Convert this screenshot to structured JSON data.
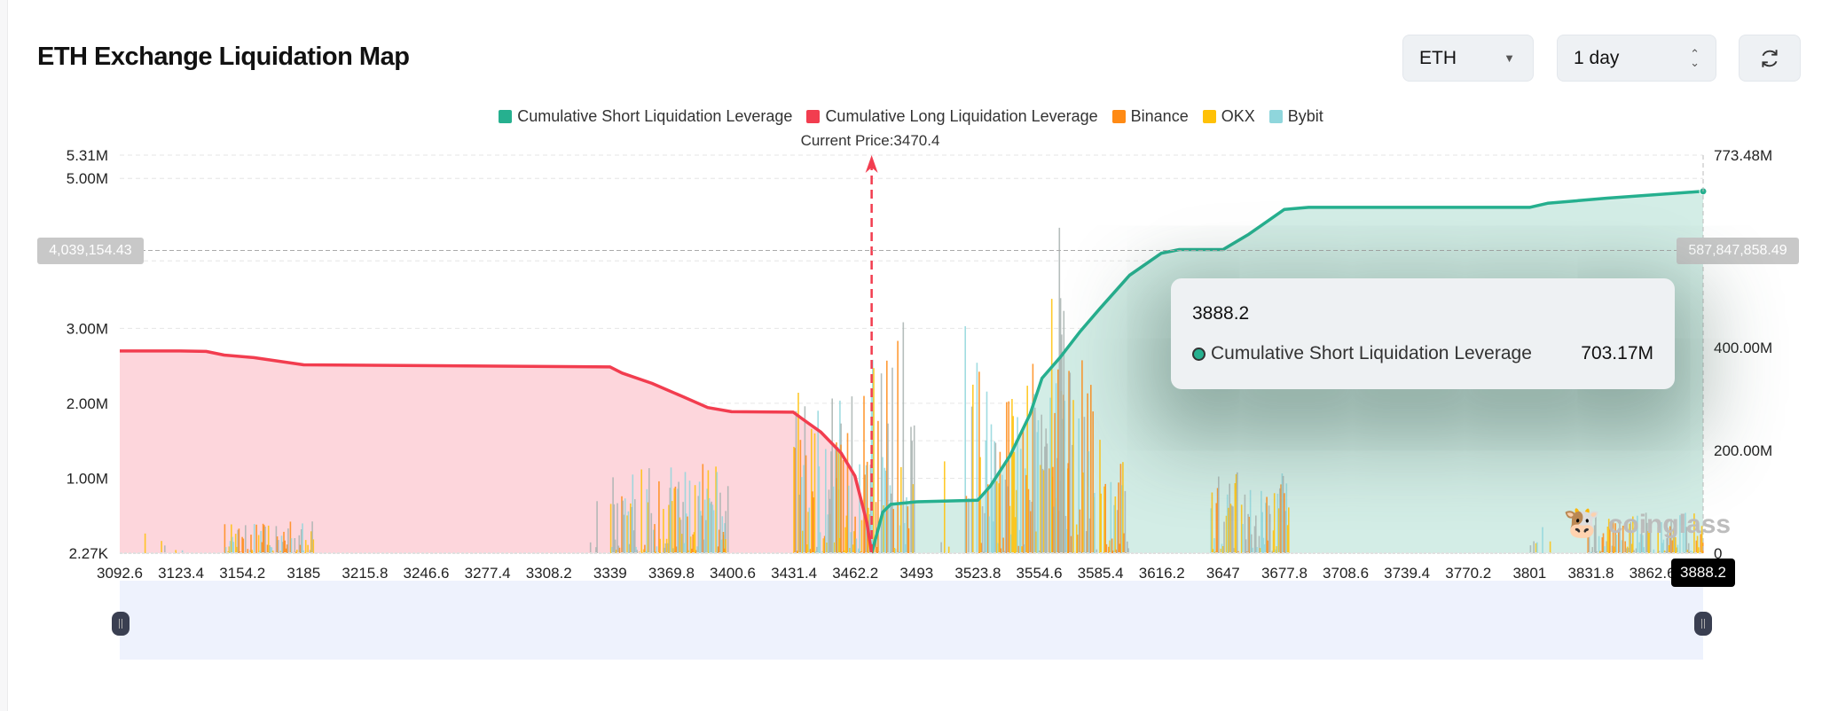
{
  "header": {
    "title": "ETH Exchange Liquidation Map",
    "coin_select": "ETH",
    "range_select": "1 day",
    "refresh_icon": "refresh-icon"
  },
  "legend": [
    {
      "label": "Cumulative Short Liquidation Leverage",
      "color": "#26b08f"
    },
    {
      "label": "Cumulative Long Liquidation Leverage",
      "color": "#f23d4f"
    },
    {
      "label": "Binance",
      "color": "#ff8a14"
    },
    {
      "label": "OKX",
      "color": "#ffc107"
    },
    {
      "label": "Bybit",
      "color": "#8fd6dc"
    }
  ],
  "current_price_label": "Current Price:3470.4",
  "tooltip": {
    "title": "3888.2",
    "series": "Cumulative Short Liquidation Leverage",
    "value": "703.17M"
  },
  "crosshair": {
    "left_value": "4,039,154.43",
    "right_value": "587,847,858.49",
    "x_value": "3888.2"
  },
  "watermark": "coinglass",
  "chart_data": {
    "type": "bar+area",
    "current_price": 3470.4,
    "x_range": [
      3092.6,
      3888.2
    ],
    "x_ticks": [
      "3092.6",
      "3123.4",
      "3154.2",
      "3185",
      "3215.8",
      "3246.6",
      "3277.4",
      "3308.2",
      "3339",
      "3369.8",
      "3400.6",
      "3431.4",
      "3462.2",
      "3493",
      "3523.8",
      "3554.6",
      "3585.4",
      "3616.2",
      "3647",
      "3677.8",
      "3708.6",
      "3739.4",
      "3770.2",
      "3801",
      "3831.8",
      "3862.6"
    ],
    "left_axis": {
      "range": [
        0,
        5.31
      ],
      "unit": "M",
      "ticks": [
        {
          "v": 5.31,
          "label": "5.31M"
        },
        {
          "v": 5.0,
          "label": "5.00M"
        },
        {
          "v": 3.0,
          "label": "3.00M"
        },
        {
          "v": 2.0,
          "label": "2.00M"
        },
        {
          "v": 1.0,
          "label": "1.00M"
        },
        {
          "v": 0,
          "label": "2.27K"
        }
      ]
    },
    "right_axis": {
      "range": [
        0,
        773.48
      ],
      "unit": "M",
      "ticks": [
        {
          "v": 773.48,
          "label": "773.48M"
        },
        {
          "v": 400,
          "label": "400.00M"
        },
        {
          "v": 200,
          "label": "200.00M"
        },
        {
          "v": 0,
          "label": "0"
        }
      ]
    },
    "grid": true,
    "legend_position": "top-center",
    "cumulative_long": [
      [
        3092.6,
        393
      ],
      [
        3123,
        393
      ],
      [
        3136,
        392
      ],
      [
        3145,
        385
      ],
      [
        3160,
        380
      ],
      [
        3185,
        366
      ],
      [
        3339,
        362
      ],
      [
        3345,
        350
      ],
      [
        3360,
        330
      ],
      [
        3375,
        305
      ],
      [
        3388,
        283
      ],
      [
        3400,
        275
      ],
      [
        3431,
        274
      ],
      [
        3436,
        260
      ],
      [
        3445,
        235
      ],
      [
        3455,
        195
      ],
      [
        3462,
        150
      ],
      [
        3468,
        60
      ],
      [
        3470.4,
        0
      ]
    ],
    "cumulative_short": [
      [
        3470.4,
        0
      ],
      [
        3476,
        80
      ],
      [
        3480,
        95
      ],
      [
        3493,
        100
      ],
      [
        3523.8,
        103
      ],
      [
        3530,
        130
      ],
      [
        3540,
        190
      ],
      [
        3550,
        270
      ],
      [
        3556,
        340
      ],
      [
        3565,
        380
      ],
      [
        3575,
        430
      ],
      [
        3585,
        475
      ],
      [
        3600,
        540
      ],
      [
        3616,
        583
      ],
      [
        3625,
        590
      ],
      [
        3647,
        590
      ],
      [
        3660,
        620
      ],
      [
        3677.8,
        668
      ],
      [
        3690,
        672
      ],
      [
        3801,
        672
      ],
      [
        3810,
        680
      ],
      [
        3840,
        690
      ],
      [
        3888.2,
        703.17
      ]
    ],
    "exchange_bar_clusters": [
      {
        "from": 3105,
        "to": 3125,
        "max": 0.3,
        "density": 0.2
      },
      {
        "from": 3145,
        "to": 3190,
        "max": 0.45,
        "density": 0.9
      },
      {
        "from": 3320,
        "to": 3336,
        "max": 0.8,
        "density": 0.25
      },
      {
        "from": 3339,
        "to": 3398,
        "max": 1.2,
        "density": 0.9
      },
      {
        "from": 3395,
        "to": 3397,
        "max": 2.1,
        "density": 1
      },
      {
        "from": 3431,
        "to": 3470,
        "max": 2.2,
        "density": 1
      },
      {
        "from": 3448,
        "to": 3455,
        "max": 4.0,
        "density": 0.4
      },
      {
        "from": 3470,
        "to": 3492,
        "max": 3.3,
        "density": 0.9
      },
      {
        "from": 3505,
        "to": 3522,
        "max": 3.7,
        "density": 0.25
      },
      {
        "from": 3523,
        "to": 3582,
        "max": 2.6,
        "density": 1
      },
      {
        "from": 3560,
        "to": 3572,
        "max": 4.9,
        "density": 0.35
      },
      {
        "from": 3582,
        "to": 3600,
        "max": 1.6,
        "density": 0.8
      },
      {
        "from": 3640,
        "to": 3680,
        "max": 1.1,
        "density": 0.9
      },
      {
        "from": 3800,
        "to": 3812,
        "max": 0.35,
        "density": 0.2
      },
      {
        "from": 3830,
        "to": 3888,
        "max": 0.55,
        "density": 0.9
      }
    ]
  }
}
